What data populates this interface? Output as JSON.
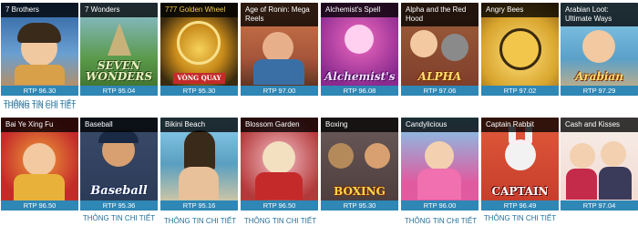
{
  "detail_label": "THÔNG TIN CHI TIẾT",
  "games": [
    {
      "title": "7 Brothers",
      "rtp": "RTP 96.30",
      "bg": "#2a5fa0",
      "accent": "#d9a04a"
    },
    {
      "title": "7 Wonders",
      "rtp": "RTP 95.04",
      "bg": "#6ea3c9",
      "accent": "#3f8a3a",
      "logo": "SEVEN WONDERS"
    },
    {
      "title": "777 Golden Wheel",
      "rtp": "RTP 95.30",
      "bg": "#3a2a10",
      "accent": "#d8a52e",
      "logo": "VÒNG QUAY"
    },
    {
      "title": "Age of Ronin: Mega Reels",
      "rtp": "RTP 97.00",
      "bg": "#a5553a",
      "accent": "#3a6fa5"
    },
    {
      "title": "Alchemist's Spell",
      "rtp": "RTP 96.08",
      "bg": "#8a2a8f",
      "accent": "#e64aa8",
      "logo": "Alchemist's"
    },
    {
      "title": "Alpha and the Red Hood",
      "rtp": "RTP 97.06",
      "bg": "#7a3a2a",
      "accent": "#c43a2a",
      "logo": "ALPHA"
    },
    {
      "title": "Angry Bees",
      "rtp": "RTP 97.02",
      "bg": "#d8a52e",
      "accent": "#f2c64a"
    },
    {
      "title": "Arabian Loot: Ultimate Ways",
      "rtp": "RTP 97.29",
      "bg": "#5aa0c8",
      "accent": "#d07a2a",
      "logo": "Arabian"
    },
    {
      "title": "Bai Ye Xing Fu",
      "rtp": "RTP 96.50",
      "bg": "#c42a2a",
      "accent": "#e8b23a"
    },
    {
      "title": "Baseball",
      "rtp": "RTP 95.36",
      "bg": "#2a3a55",
      "accent": "#e2e2e2",
      "logo": "Baseball"
    },
    {
      "title": "Bikini Beach",
      "rtp": "RTP 95.16",
      "bg": "#5a9fc0",
      "accent": "#e8c09a"
    },
    {
      "title": "Blossom Garden",
      "rtp": "RTP 96.50",
      "bg": "#b33a3a",
      "accent": "#f0c3c8"
    },
    {
      "title": "Boxing",
      "rtp": "RTP 95.30",
      "bg": "#4a3a3a",
      "accent": "#b58a5a",
      "logo": "BOXING"
    },
    {
      "title": "Candylicious",
      "rtp": "RTP 96.00",
      "bg": "#e05aa0",
      "accent": "#7ad0f0"
    },
    {
      "title": "Captain Rabbit",
      "rtp": "RTP 96.49",
      "bg": "#c43a2a",
      "accent": "#f2f2f2",
      "logo": "CAPTAIN"
    },
    {
      "title": "Cash and Kisses",
      "rtp": "RTP 97.04",
      "bg": "#f0d8d0",
      "accent": "#c42a4a"
    }
  ]
}
